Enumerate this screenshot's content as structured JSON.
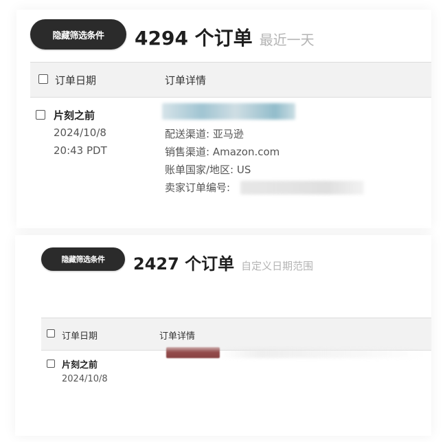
{
  "panels": [
    {
      "filter_button": "隐藏筛选条件",
      "order_count": "4294 个订单",
      "date_range": "最近一天",
      "table": {
        "columns": [
          "订单日期",
          "订单详情"
        ]
      },
      "order": {
        "title": "片刻之前",
        "date": "2024/10/8",
        "time": "20:43 PDT",
        "details": [
          "配送渠道: 亚马逊",
          "销售渠道: Amazon.com",
          "账单国家/地区: US",
          "卖家订单编号:"
        ]
      }
    },
    {
      "filter_button": "隐藏筛选条件",
      "order_count": "2427 个订单",
      "date_range": "自定义日期范围",
      "table": {
        "columns": [
          "订单日期",
          "订单详情"
        ]
      },
      "order": {
        "title": "片刻之前",
        "date": "2024/10/8"
      }
    }
  ],
  "colors": {
    "button_bg": "#2b2b2b",
    "header_bg": "#f2f2f2",
    "muted_text": "#b4b4b4"
  },
  "icons": {
    "checkbox": "empty-checkbox-icon"
  }
}
